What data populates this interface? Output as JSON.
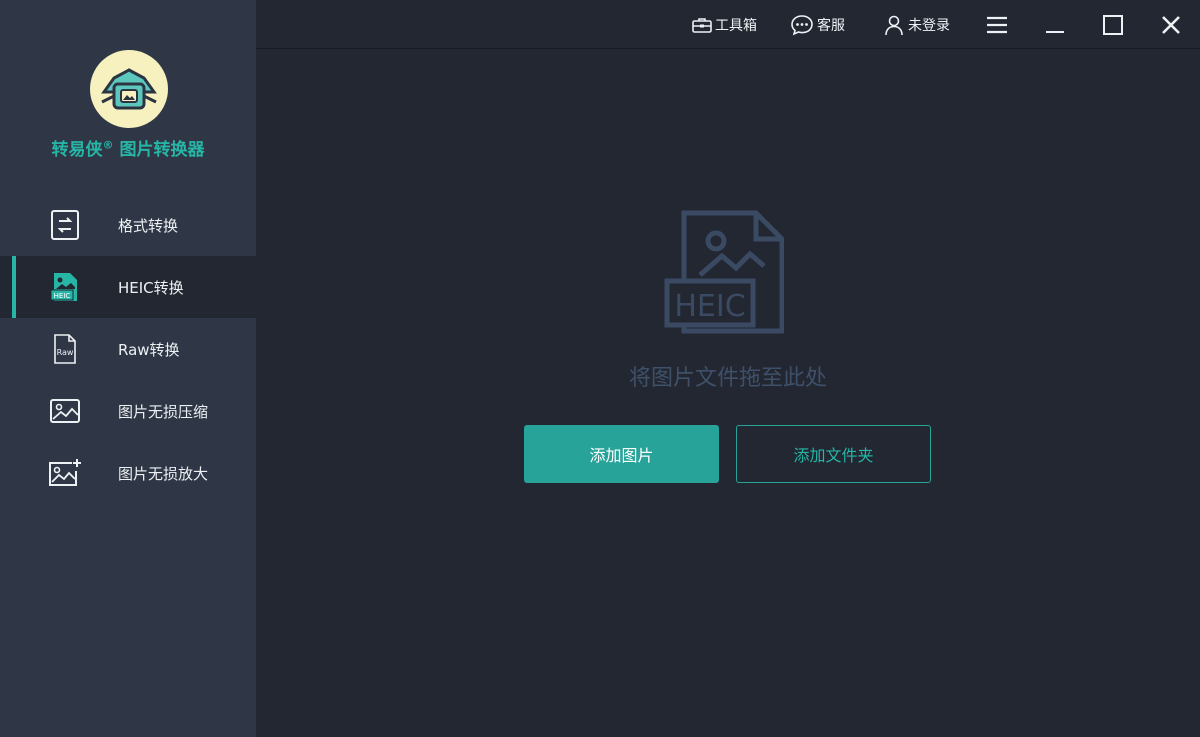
{
  "app": {
    "brand_name": "转易侠",
    "brand_mark": "®",
    "brand_product": " 图片转换器"
  },
  "sidebar": {
    "items": [
      {
        "label": "格式转换",
        "icon": "format-convert-icon",
        "active": false
      },
      {
        "label": "HEIC转换",
        "icon": "heic-file-icon",
        "active": true
      },
      {
        "label": "Raw转换",
        "icon": "raw-file-icon",
        "active": false
      },
      {
        "label": "图片无损压缩",
        "icon": "image-compress-icon",
        "active": false
      },
      {
        "label": "图片无损放大",
        "icon": "image-enlarge-icon",
        "active": false
      }
    ]
  },
  "topbar": {
    "toolbox_label": "工具箱",
    "service_label": "客服",
    "login_label": "未登录"
  },
  "main": {
    "drop_icon_text": "HEIC",
    "drop_text": "将图片文件拖至此处",
    "add_image_label": "添加图片",
    "add_folder_label": "添加文件夹"
  },
  "colors": {
    "accent": "#27b5a6",
    "sidebar_bg": "#2f3746",
    "main_bg": "#222732"
  }
}
